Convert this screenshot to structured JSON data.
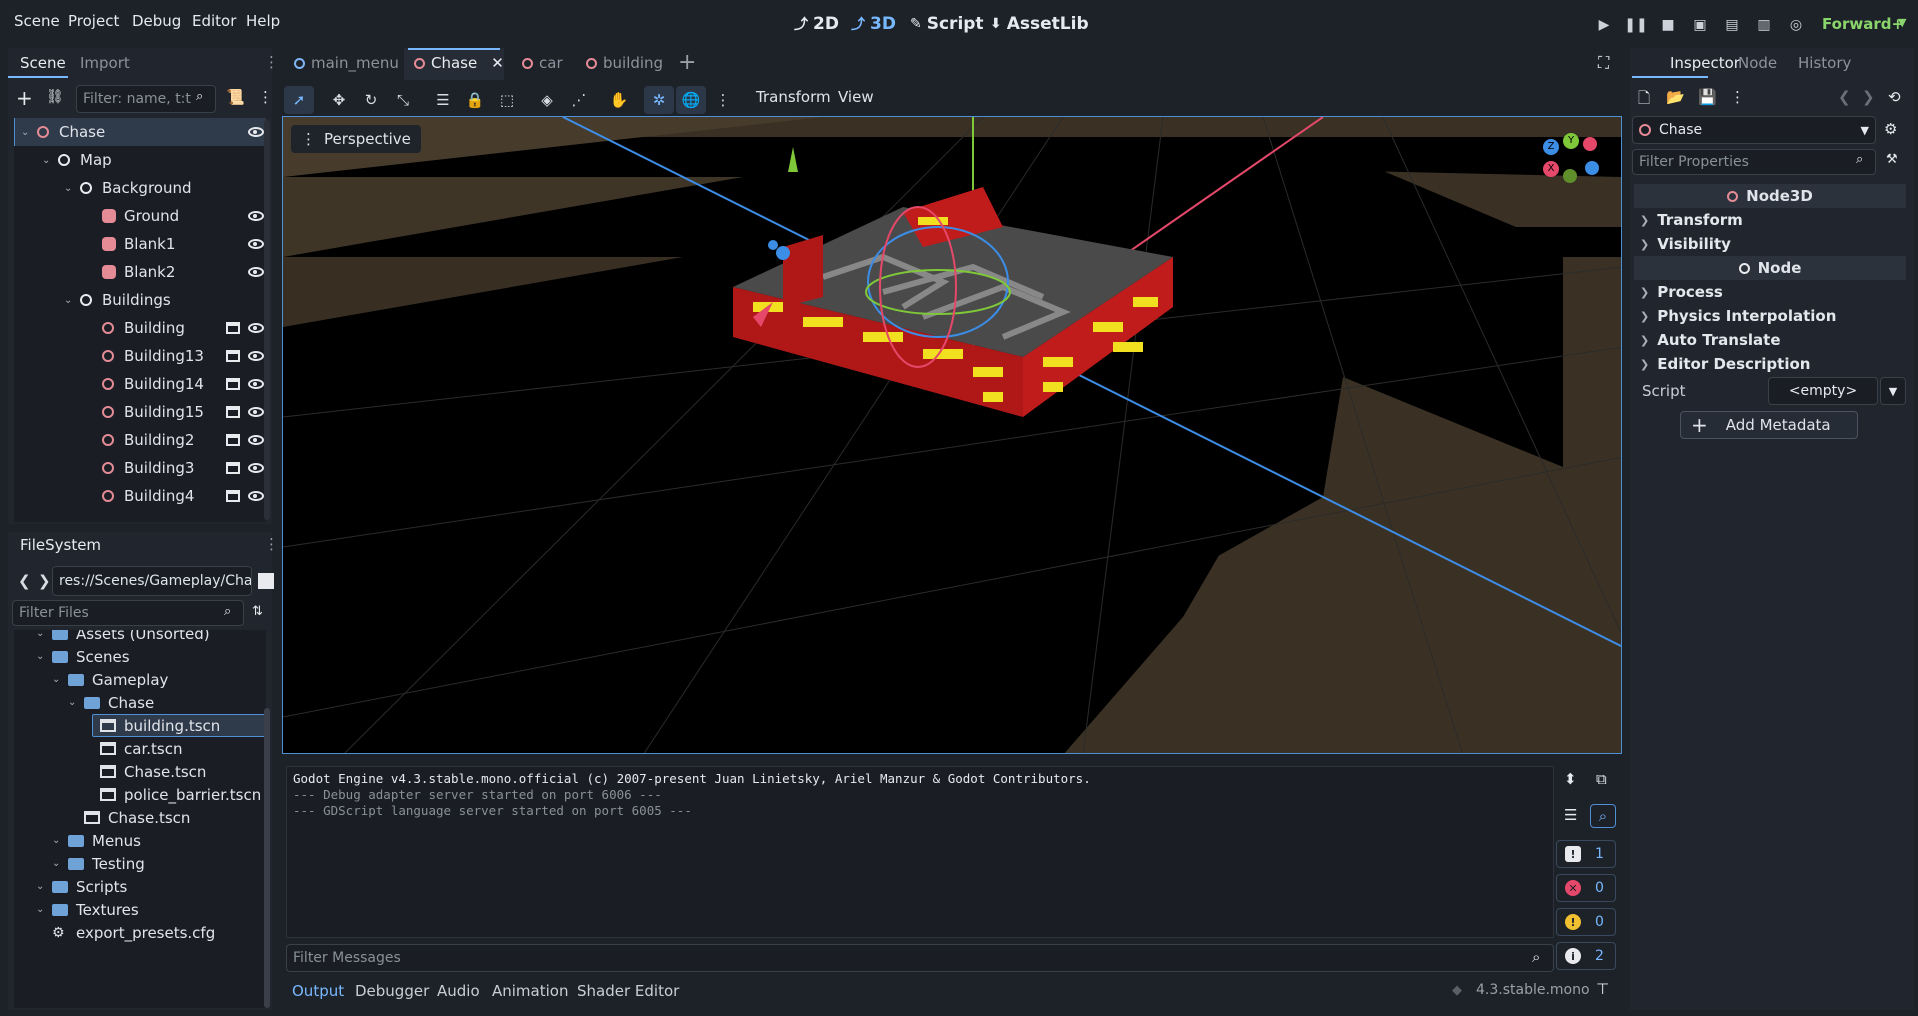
{
  "menu": [
    "Scene",
    "Project",
    "Debug",
    "Editor",
    "Help"
  ],
  "modes": [
    {
      "label": "2D"
    },
    {
      "label": "3D"
    },
    {
      "label": "Script"
    },
    {
      "label": "AssetLib"
    }
  ],
  "renderer": "Forward+",
  "left_tabs": {
    "scene": "Scene",
    "import": "Import"
  },
  "scene_filter_placeholder": "Filter: name, t:t",
  "scene_tree": [
    {
      "label": "Chase",
      "depth": 0,
      "icon": "node3d-icon",
      "eye": true,
      "clap": false,
      "selected": true
    },
    {
      "label": "Map",
      "depth": 1,
      "icon": "node3d-white-icon",
      "eye": false,
      "clap": false
    },
    {
      "label": "Background",
      "depth": 2,
      "icon": "node3d-white-icon",
      "eye": false,
      "clap": false
    },
    {
      "label": "Ground",
      "depth": 3,
      "icon": "mesh-icon",
      "eye": true,
      "clap": false
    },
    {
      "label": "Blank1",
      "depth": 3,
      "icon": "mesh-icon",
      "eye": true,
      "clap": false
    },
    {
      "label": "Blank2",
      "depth": 3,
      "icon": "mesh-icon",
      "eye": true,
      "clap": false
    },
    {
      "label": "Buildings",
      "depth": 2,
      "icon": "node3d-white-icon",
      "eye": false,
      "clap": false
    },
    {
      "label": "Building",
      "depth": 3,
      "icon": "node3d-icon",
      "eye": true,
      "clap": true
    },
    {
      "label": "Building13",
      "depth": 3,
      "icon": "node3d-icon",
      "eye": true,
      "clap": true
    },
    {
      "label": "Building14",
      "depth": 3,
      "icon": "node3d-icon",
      "eye": true,
      "clap": true
    },
    {
      "label": "Building15",
      "depth": 3,
      "icon": "node3d-icon",
      "eye": true,
      "clap": true
    },
    {
      "label": "Building2",
      "depth": 3,
      "icon": "node3d-icon",
      "eye": true,
      "clap": true
    },
    {
      "label": "Building3",
      "depth": 3,
      "icon": "node3d-icon",
      "eye": true,
      "clap": true
    },
    {
      "label": "Building4",
      "depth": 3,
      "icon": "node3d-icon",
      "eye": true,
      "clap": true
    }
  ],
  "filesystem": {
    "title": "FileSystem",
    "path": "res://Scenes/Gameplay/Cha",
    "filter_placeholder": "Filter Files",
    "items": [
      {
        "label": "Assets (Unsorted)",
        "depth": 1,
        "type": "folder"
      },
      {
        "label": "Scenes",
        "depth": 1,
        "type": "folder"
      },
      {
        "label": "Gameplay",
        "depth": 2,
        "type": "folder"
      },
      {
        "label": "Chase",
        "depth": 3,
        "type": "folder"
      },
      {
        "label": "building.tscn",
        "depth": 4,
        "type": "scene",
        "selected": true
      },
      {
        "label": "car.tscn",
        "depth": 4,
        "type": "scene"
      },
      {
        "label": "Chase.tscn",
        "depth": 4,
        "type": "scene"
      },
      {
        "label": "police_barrier.tscn",
        "depth": 4,
        "type": "scene"
      },
      {
        "label": "Chase.tscn",
        "depth": 3,
        "type": "scene"
      },
      {
        "label": "Menus",
        "depth": 2,
        "type": "folder"
      },
      {
        "label": "Testing",
        "depth": 2,
        "type": "folder"
      },
      {
        "label": "Scripts",
        "depth": 1,
        "type": "folder"
      },
      {
        "label": "Textures",
        "depth": 1,
        "type": "folder"
      },
      {
        "label": "export_presets.cfg",
        "depth": 1,
        "type": "gear"
      }
    ]
  },
  "editor_tabs": [
    {
      "label": "main_menu",
      "color": "#7fb4f5"
    },
    {
      "label": "Chase",
      "color": "#e58b96",
      "active": true
    },
    {
      "label": "car",
      "color": "#e58b96"
    },
    {
      "label": "building",
      "color": "#e58b96"
    }
  ],
  "viewport_menus": {
    "transform": "Transform",
    "view": "View"
  },
  "viewport_label": "Perspective",
  "gizmo": {
    "x": "X",
    "y": "Y",
    "z": "Z"
  },
  "output": {
    "lines": [
      "Godot Engine v4.3.stable.mono.official (c) 2007-present Juan Linietsky, Ariel Manzur & Godot Contributors.",
      "--- Debug adapter server started on port 6006 ---",
      "--- GDScript language server started on port 6005 ---"
    ],
    "filter_placeholder": "Filter Messages",
    "counts": {
      "messages": "1",
      "errors": "0",
      "warnings": "0",
      "info": "2"
    }
  },
  "bottom_tabs": [
    "Output",
    "Debugger",
    "Audio",
    "Animation",
    "Shader Editor"
  ],
  "version": "4.3.stable.mono",
  "inspector": {
    "tabs": [
      "Inspector",
      "Node",
      "History"
    ],
    "object": "Chase",
    "filter_placeholder": "Filter Properties",
    "section1": "Node3D",
    "groups1": [
      "Transform",
      "Visibility"
    ],
    "section2": "Node",
    "groups2": [
      "Process",
      "Physics Interpolation",
      "Auto Translate",
      "Editor Description"
    ],
    "script_label": "Script",
    "script_value": "<empty>",
    "add_metadata": "Add Metadata"
  },
  "colors": {
    "accent": "#78b8ff",
    "node3d": "#e58b96",
    "folder": "#6fa3d8",
    "background": "#1d2229"
  }
}
